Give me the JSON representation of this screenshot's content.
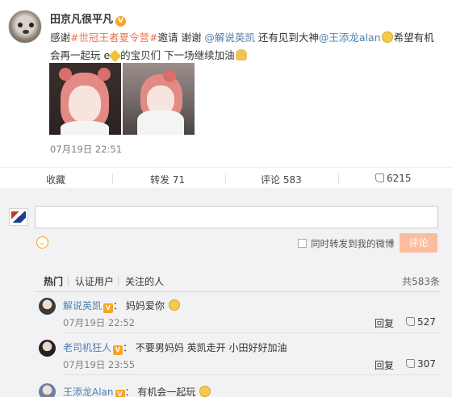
{
  "post": {
    "username": "田京凡很平凡",
    "verified_badge": "V",
    "text_parts": {
      "p1": "感谢",
      "hashtag": "#世冠王者夏令营#",
      "p2": "邀请 谢谢 ",
      "mention1": "@解说英凯",
      "p3": " 还有见到大神",
      "mention2": "@王添龙alan",
      "p4": "希望有机会再一起玩 e",
      "p5": "的宝贝们 下一场继续加油"
    },
    "timestamp": "07月19日 22:51",
    "photos": [
      "photo-1",
      "photo-2"
    ]
  },
  "actions": {
    "favorite": "收藏",
    "repost": "转发 71",
    "comment": "评论 583",
    "like": "6215"
  },
  "comment_box": {
    "placeholder": "",
    "also_repost_label": "同时转发到我的微博",
    "submit_label": "评论"
  },
  "tabs": {
    "hot": "热门",
    "verified": "认证用户",
    "following": "关注的人",
    "total": "共583条"
  },
  "comments": [
    {
      "name": "解说英凯",
      "badge": "V",
      "text": "妈妈爱你",
      "time": "07月19日 22:52",
      "reply": "回复",
      "likes": "527"
    },
    {
      "name": "老司机狂人",
      "badge": "V",
      "text": "不要男妈妈 英凯走开 小田好好加油",
      "time": "07月19日 23:55",
      "reply": "回复",
      "likes": "307"
    },
    {
      "name": "王添龙Alan",
      "badge": "V",
      "text": "有机会一起玩"
    }
  ],
  "colors": {
    "link_orange": "#eb7350",
    "mention_blue": "#507daf",
    "button_disabled": "#fbbd9e",
    "badge_gold": "#f5a623"
  },
  "icons": [
    "smile-icon",
    "thumb-up-icon",
    "verified-badge-icon"
  ]
}
